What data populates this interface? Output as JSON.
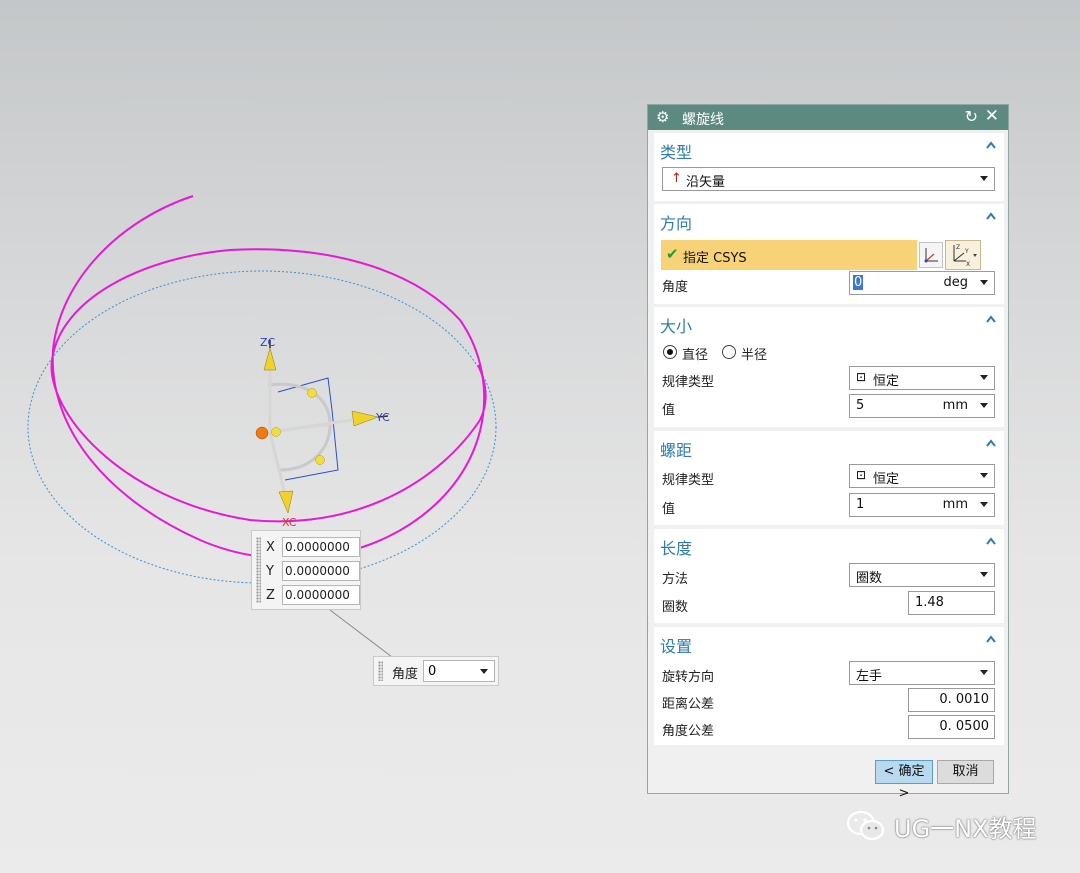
{
  "viewport": {
    "axis_labels": {
      "z": "ZC",
      "y": "YC",
      "x": "XC"
    },
    "colors": {
      "helix": "#e619d6",
      "preview": "#3a8fd6",
      "handle_yellow": "#f0d22a",
      "origin": "#f07a10"
    }
  },
  "coord_input": {
    "x_label": "X",
    "x_value": "0.0000000",
    "y_label": "Y",
    "y_value": "0.0000000",
    "z_label": "Z",
    "z_value": "0.0000000"
  },
  "angle_input": {
    "label": "角度",
    "value": "0"
  },
  "dialog": {
    "title": "螺旋线",
    "type_group": {
      "header": "类型",
      "value": "沿矢量"
    },
    "direction_group": {
      "header": "方向",
      "csys_label": "指定 CSYS",
      "angle_label": "角度",
      "angle_value": "0",
      "angle_unit": "deg"
    },
    "size_group": {
      "header": "大小",
      "radio_diameter": "直径",
      "radio_radius": "半径",
      "law_type_label": "规律类型",
      "law_type_value": "恒定",
      "value_label": "值",
      "value": "5",
      "unit": "mm"
    },
    "pitch_group": {
      "header": "螺距",
      "law_type_label": "规律类型",
      "law_type_value": "恒定",
      "value_label": "值",
      "value": "1",
      "unit": "mm"
    },
    "length_group": {
      "header": "长度",
      "method_label": "方法",
      "method_value": "圈数",
      "turns_label": "圈数",
      "turns_value": "1.48"
    },
    "settings_group": {
      "header": "设置",
      "rotation_label": "旋转方向",
      "rotation_value": "左手",
      "dist_tol_label": "距离公差",
      "dist_tol_value": "0. 0010",
      "angle_tol_label": "角度公差",
      "angle_tol_value": "0. 0500"
    },
    "ok_label": "< 确定 >",
    "cancel_label": "取消"
  },
  "watermark": {
    "text": "UG一NX教程"
  }
}
